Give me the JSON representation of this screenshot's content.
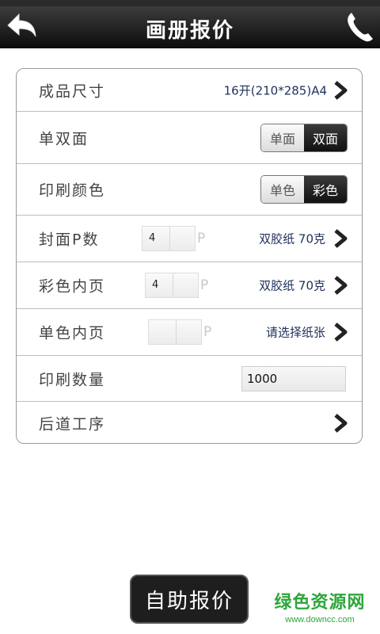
{
  "header": {
    "title": "画册报价",
    "back_icon": "back-arrow-icon",
    "phone_icon": "phone-icon",
    "colors": {
      "bar_top": "#3c3c3c",
      "bar_bottom": "#0d0d0d",
      "text": "#ffffff"
    }
  },
  "form": {
    "rows": [
      {
        "label": "成品尺寸",
        "value": "16开(210*285)A4"
      },
      {
        "label": "单双面",
        "options": [
          "单面",
          "双面"
        ],
        "selected": "双面"
      },
      {
        "label": "印刷颜色",
        "options": [
          "单色",
          "彩色"
        ],
        "selected": "彩色"
      },
      {
        "label": "封面P数",
        "p_value": "4",
        "unit": "P",
        "value": "双胶纸 70克"
      },
      {
        "label": "彩色内页",
        "p_value": "4",
        "unit": "P",
        "value": "双胶纸 70克"
      },
      {
        "label": "单色内页",
        "p_value": "",
        "unit": "P",
        "value": "请选择纸张"
      },
      {
        "label": "印刷数量",
        "value": "1000"
      },
      {
        "label": "后道工序"
      }
    ]
  },
  "submit_button": {
    "label": "自助报价"
  },
  "watermark": {
    "main": "绿色资源网",
    "sub": "www.downcc.com",
    "color": "#2ea63a"
  }
}
